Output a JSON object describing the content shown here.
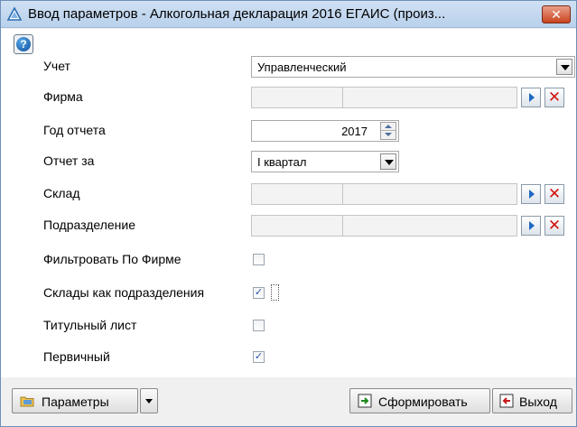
{
  "window": {
    "title": "Ввод параметров - Алкогольная декларация 2016 ЕГАИС (произ...",
    "close_label": "✕",
    "colors": {
      "titlebar": "#b9d1ec",
      "close": "#c8431f",
      "accent": "#1e68c2",
      "delete": "#d0140f"
    }
  },
  "help": {
    "icon": "help-icon",
    "glyph": "?"
  },
  "form": {
    "uchet": {
      "label": "Учет",
      "value": "Управленческий"
    },
    "firma": {
      "label": "Фирма"
    },
    "god": {
      "label": "Год отчета",
      "value": "2017"
    },
    "otchet_za": {
      "label": "Отчет за",
      "value": "I квартал"
    },
    "sklad": {
      "label": "Склад"
    },
    "podrazdelenie": {
      "label": "Подразделение"
    },
    "filtr": {
      "label": "Фильтровать По Фирме",
      "checked": false
    },
    "sklady_kak": {
      "label": "Склады как подразделения",
      "checked": true
    },
    "titul": {
      "label": "Титульный лист",
      "checked": false
    },
    "pervichny": {
      "label": "Первичный",
      "checked": true
    },
    "check_mark": "✓",
    "delete_glyph": "✕"
  },
  "buttons": {
    "params": "Параметры",
    "form": "Сформировать",
    "exit": "Выход"
  }
}
